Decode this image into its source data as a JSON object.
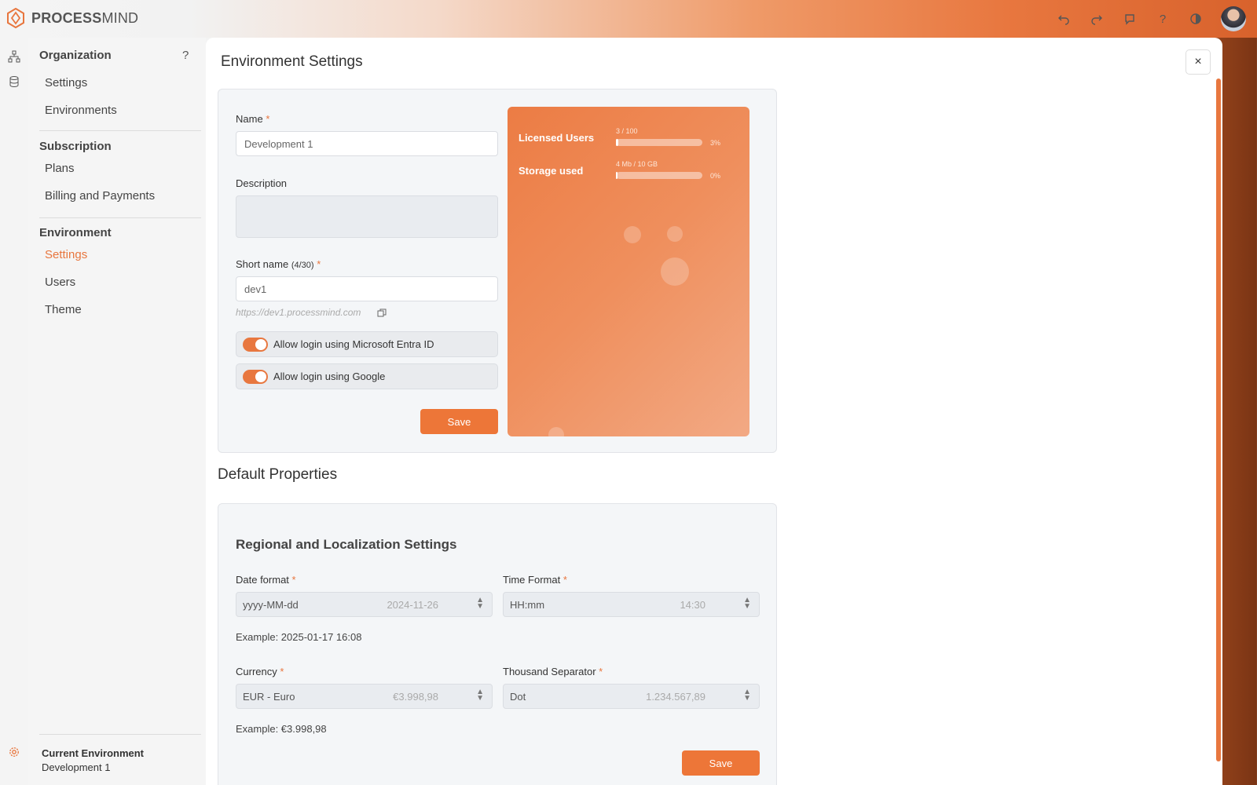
{
  "app": {
    "brand_bold": "PROCESS",
    "brand_light": "MIND"
  },
  "topbar": {
    "icons": [
      "undo-icon",
      "redo-icon",
      "comment-icon",
      "help-icon",
      "theme-icon"
    ]
  },
  "sidebar": {
    "help": "?",
    "sections": [
      {
        "title": "Organization",
        "items": [
          "Settings",
          "Environments"
        ]
      },
      {
        "title": "Subscription",
        "items": [
          "Plans",
          "Billing and Payments"
        ]
      },
      {
        "title": "Environment",
        "items": [
          "Settings",
          "Users",
          "Theme"
        ]
      }
    ],
    "active_item": "Environment/Settings",
    "current_env_label": "Current Environment",
    "current_env_value": "Development 1"
  },
  "page": {
    "title": "Environment Settings",
    "close": "×"
  },
  "env_form": {
    "name_label": "Name",
    "name_value": "Development 1",
    "description_label": "Description",
    "description_value": "",
    "short_name_label": "Short name",
    "short_name_counter": "(4/30)",
    "short_name_value": "dev1",
    "url": "https://dev1.processmind.com",
    "toggle_entra": "Allow login using Microsoft Entra ID",
    "toggle_google": "Allow login using Google",
    "save": "Save",
    "required_mark": "*"
  },
  "usage": {
    "licensed_users_label": "Licensed Users",
    "licensed_users_meta": "3 / 100",
    "licensed_users_pct": "3%",
    "licensed_users_fraction": 0.03,
    "storage_label": "Storage used",
    "storage_meta": "4 Mb / 10 GB",
    "storage_pct": "0%",
    "storage_fraction": 0.0
  },
  "defaults": {
    "title": "Default Properties",
    "subtitle": "Regional and Localization Settings",
    "date_format_label": "Date format",
    "date_format_value": "yyyy-MM-dd",
    "date_format_example": "2024-11-26",
    "time_format_label": "Time Format",
    "time_format_value": "HH:mm",
    "time_format_example": "14:30",
    "datetime_example": "Example: 2025-01-17 16:08",
    "currency_label": "Currency",
    "currency_value": "EUR - Euro",
    "currency_example": "€3.998,98",
    "separator_label": "Thousand Separator",
    "separator_value": "Dot",
    "separator_example": "1.234.567,89",
    "currency_full_example": "Example: €3.998,98",
    "save": "Save"
  },
  "colors": {
    "accent": "#e8763e",
    "usage_card_start": "#ec7c44",
    "usage_card_end": "#f2a984"
  }
}
